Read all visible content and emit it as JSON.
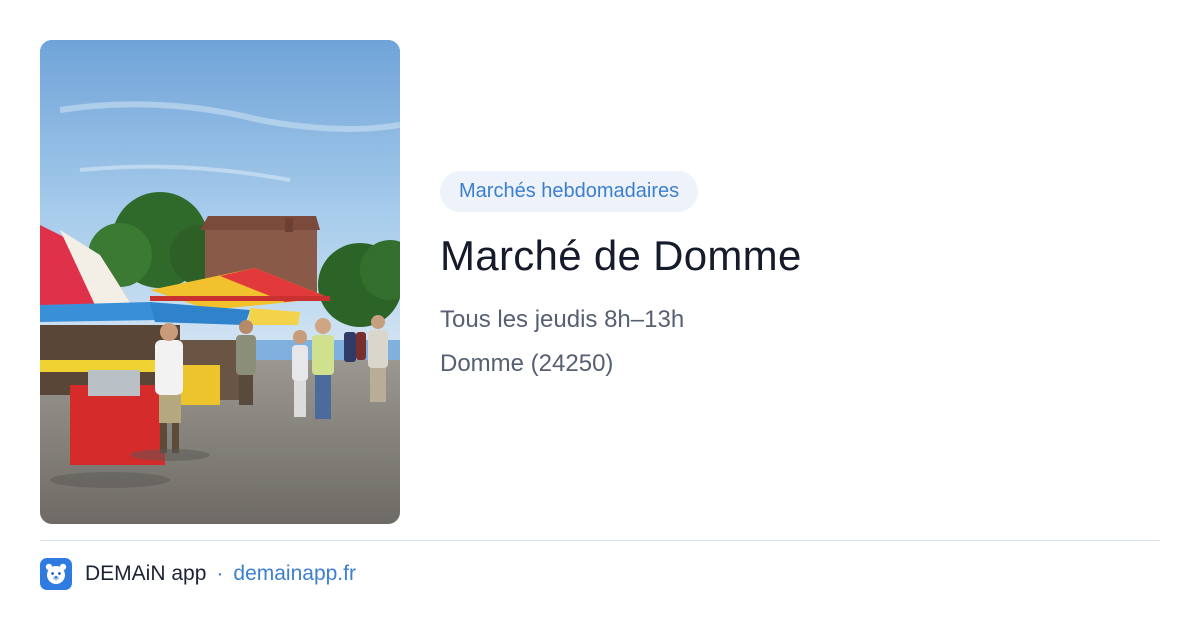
{
  "card": {
    "image_alt": "Marché en plein air avec parasols colorés",
    "category_badge": "Marchés hebdomadaires",
    "title": "Marché de Domme",
    "schedule": "Tous les jeudis 8h–13h",
    "location": "Domme (24250)"
  },
  "footer": {
    "app_icon": "bear-face-icon",
    "app_name": "DEMAiN app",
    "separator": "·",
    "website": "demainapp.fr"
  },
  "colors": {
    "accent": "#3c7fcf",
    "badge_bg": "#eef3fb",
    "title": "#151b2b",
    "muted": "#566072",
    "divider": "#dbe3ea"
  }
}
